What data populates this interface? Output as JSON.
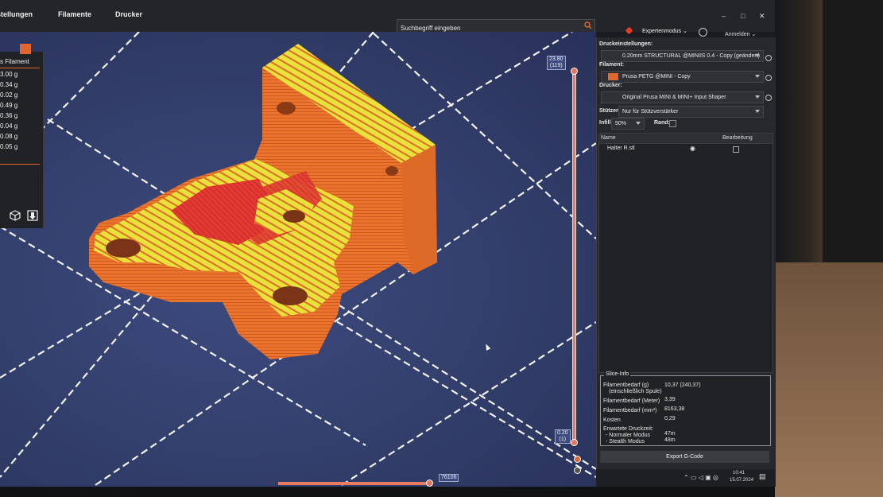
{
  "topbar": {
    "tabs": [
      "stellungen",
      "Filamente",
      "Drucker"
    ],
    "search_placeholder": "Suchbegriff eingeben",
    "mode_label": "Expertenmodus",
    "login_label": "Anmelden"
  },
  "filament_panel": {
    "header": "s Filament",
    "weights": [
      "3.00 g",
      "0.34 g",
      "0.02 g",
      "0.49 g",
      "0.36 g",
      "0.04 g",
      "0.08 g",
      "0.05 g"
    ]
  },
  "sidebar": {
    "print_settings_label": "Druckeinstellungen:",
    "print_settings_value": "0.20mm STRUCTURAL @MINIIS 0.4 - Copy (geändert)",
    "filament_label": "Filament:",
    "filament_value": "Prusa PETG @MINI - Copy",
    "filament_color": "#e2672f",
    "printer_label": "Drucker:",
    "printer_value": "Original Prusa MINI & MINI+ Input Shaper",
    "supports_label": "Stützen:",
    "supports_value": "Nur für Stützverstärker",
    "infill_label": "Infill:",
    "infill_value": "50%",
    "brim_label": "Rand:",
    "columns": [
      "Name",
      "Bearbeitung"
    ],
    "objects": [
      {
        "name": "Halter R.stl"
      }
    ]
  },
  "slice_info": {
    "title": "Slice-Info",
    "rows": [
      {
        "label": "Filamentbedarf (g)",
        "label2": "(einschließlich Spule)",
        "value": "10,37 (240,37)"
      },
      {
        "label": "Filamentbedarf (Meter)",
        "value": "3,39"
      },
      {
        "label": "Filamentbedarf (mm³)",
        "value": "8163,38"
      },
      {
        "label": "Kosten",
        "value": "0,29"
      },
      {
        "label": "Erwartete Druckzeit:",
        "value": ""
      },
      {
        "label": "- Normaler Modus",
        "value": "47m"
      },
      {
        "label": "- Stealth Modus",
        "value": "48m"
      }
    ],
    "export_label": "Export G-Code"
  },
  "layer_slider": {
    "top_height": "23.80",
    "top_layer": "(119)",
    "bottom_height": "0.20",
    "bottom_layer": "(1)",
    "horizontal_value": "76106"
  },
  "taskbar": {
    "time": "10:41",
    "date": "15.07.2024"
  }
}
